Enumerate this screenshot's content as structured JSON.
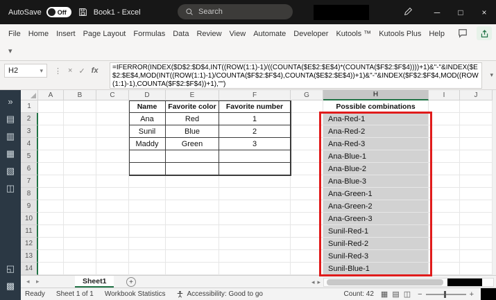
{
  "title_bar": {
    "autosave_label": "AutoSave",
    "autosave_state": "Off",
    "workbook_title": "Book1 - Excel",
    "search_placeholder": "Search"
  },
  "ribbon": {
    "tabs": [
      "File",
      "Home",
      "Insert",
      "Page Layout",
      "Formulas",
      "Data",
      "Review",
      "View",
      "Automate",
      "Developer",
      "Kutools ™",
      "Kutools Plus",
      "Help"
    ]
  },
  "formula_bar": {
    "name_box": "H2",
    "formula": "=IFERROR(INDEX($D$2:$D$4,INT((ROW(1:1)-1)/((COUNTA($E$2:$E$4)*(COUNTA($F$2:$F$4))))+1)&\"-\"&INDEX($E$2:$E$4,MOD(INT((ROW(1:1)-1)/COUNTA($F$2:$F$4),COUNTA($E$2:$E$4))+1)&\"-\"&INDEX($F$2:$F$4,MOD((ROW(1:1)-1),COUNTA($F$2:$F$4))+1),\"\")"
  },
  "sheet": {
    "columns": [
      "A",
      "B",
      "C",
      "D",
      "E",
      "F",
      "G",
      "H",
      "I",
      "J"
    ],
    "row_count": 14,
    "selected_column": "H",
    "selection_range": "H2:H14",
    "table": {
      "headers": [
        "Name",
        "Favorite color",
        "Favorite number"
      ],
      "rows": [
        [
          "Ana",
          "Red",
          "1"
        ],
        [
          "Sunil",
          "Blue",
          "2"
        ],
        [
          "Maddy",
          "Green",
          "3"
        ],
        [
          "",
          "",
          ""
        ],
        [
          "",
          "",
          ""
        ]
      ]
    },
    "combinations": {
      "header": "Possible combinations",
      "values": [
        "Ana-Red-1",
        "Ana-Red-2",
        "Ana-Red-3",
        "Ana-Blue-1",
        "Ana-Blue-2",
        "Ana-Blue-3",
        "Ana-Green-1",
        "Ana-Green-2",
        "Ana-Green-3",
        "Sunil-Red-1",
        "Sunil-Red-2",
        "Sunil-Red-3",
        "Sunil-Blue-1"
      ]
    }
  },
  "sheet_tabs": {
    "active": "Sheet1"
  },
  "status_bar": {
    "ready": "Ready",
    "sheet_info": "Sheet 1 of 1",
    "workbook_stats": "Workbook Statistics",
    "accessibility": "Accessibility: Good to go",
    "count": "Count: 42"
  },
  "sidebar": {
    "top_icons": [
      {
        "name": "collapse-pane-icon",
        "glyph": "»"
      },
      {
        "name": "workbook-list-icon",
        "glyph": "▤"
      },
      {
        "name": "worksheet-list-icon",
        "glyph": "▥"
      },
      {
        "name": "columns-pane-icon",
        "glyph": "▦"
      },
      {
        "name": "clipboard-pane-icon",
        "glyph": "▧"
      },
      {
        "name": "advanced-find-icon",
        "glyph": "◫"
      }
    ],
    "bottom_icons": [
      {
        "name": "resize-pane-icon",
        "glyph": "◱"
      },
      {
        "name": "pane-settings-icon",
        "glyph": "▩"
      }
    ]
  },
  "icons": {
    "minimize": "─",
    "maximize": "□",
    "close": "×",
    "dropdown": "▾",
    "more_vertical": "⋮",
    "cancel": "×",
    "confirm": "✓",
    "fx": "fx",
    "nav_left": "◂",
    "nav_right": "▸",
    "add": "+",
    "zoom_out": "−",
    "zoom_in": "+",
    "view_icons": [
      {
        "name": "normal-view-icon",
        "glyph": "▦"
      },
      {
        "name": "page-layout-view-icon",
        "glyph": "▤"
      },
      {
        "name": "page-break-view-icon",
        "glyph": "◫"
      }
    ]
  },
  "colors": {
    "accent_green": "#217346",
    "annotation_red": "#e01b1b",
    "selection_fill": "#d2d2d2",
    "titlebar_bg": "#171717"
  }
}
